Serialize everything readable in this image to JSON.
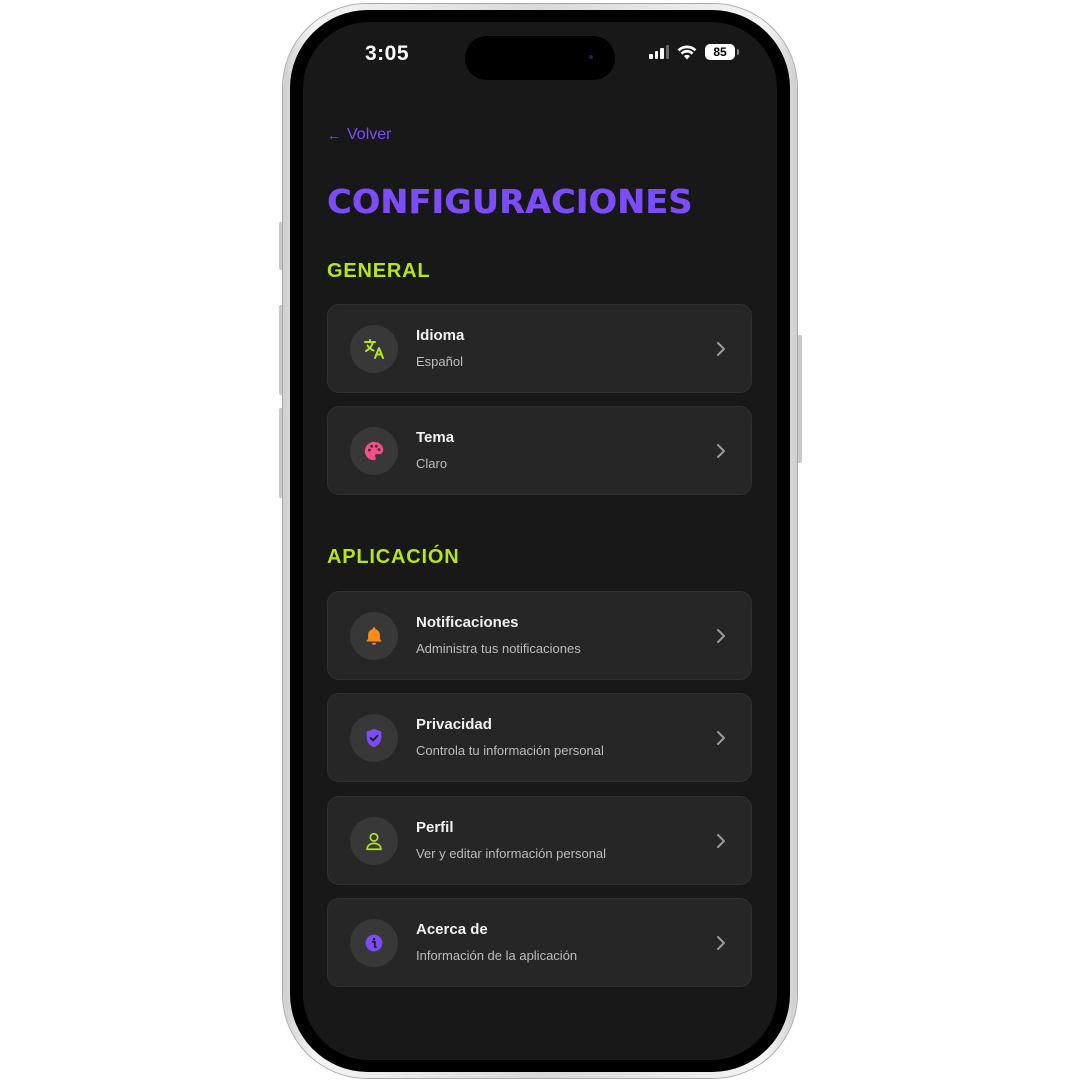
{
  "status_bar": {
    "time": "3:05",
    "battery": "85"
  },
  "nav": {
    "back_label": "Volver"
  },
  "page": {
    "title": "CONFIGURACIONES"
  },
  "sections": [
    {
      "title": "GENERAL",
      "items": [
        {
          "title": "Idioma",
          "subtitle": "Español",
          "icon": "translate-icon",
          "icon_color": "#b6e51c"
        },
        {
          "title": "Tema",
          "subtitle": "Claro",
          "icon": "palette-icon",
          "icon_color": "#ff4f8b"
        }
      ]
    },
    {
      "title": "APLICACIÓN",
      "items": [
        {
          "title": "Notificaciones",
          "subtitle": "Administra tus notificaciones",
          "icon": "bell-icon",
          "icon_color": "#ff8a1c"
        },
        {
          "title": "Privacidad",
          "subtitle": "Controla tu información personal",
          "icon": "shield-check-icon",
          "icon_color": "#7c4dff"
        },
        {
          "title": "Perfil",
          "subtitle": "Ver y editar información personal",
          "icon": "user-icon",
          "icon_color": "#b6e51c"
        },
        {
          "title": "Acerca de",
          "subtitle": "Información de la aplicación",
          "icon": "info-icon",
          "icon_color": "#7c4dff"
        }
      ]
    }
  ],
  "colors": {
    "accent": "#7c4dff",
    "section_title": "#b6e51c",
    "background": "#181818",
    "card": "#262626"
  }
}
